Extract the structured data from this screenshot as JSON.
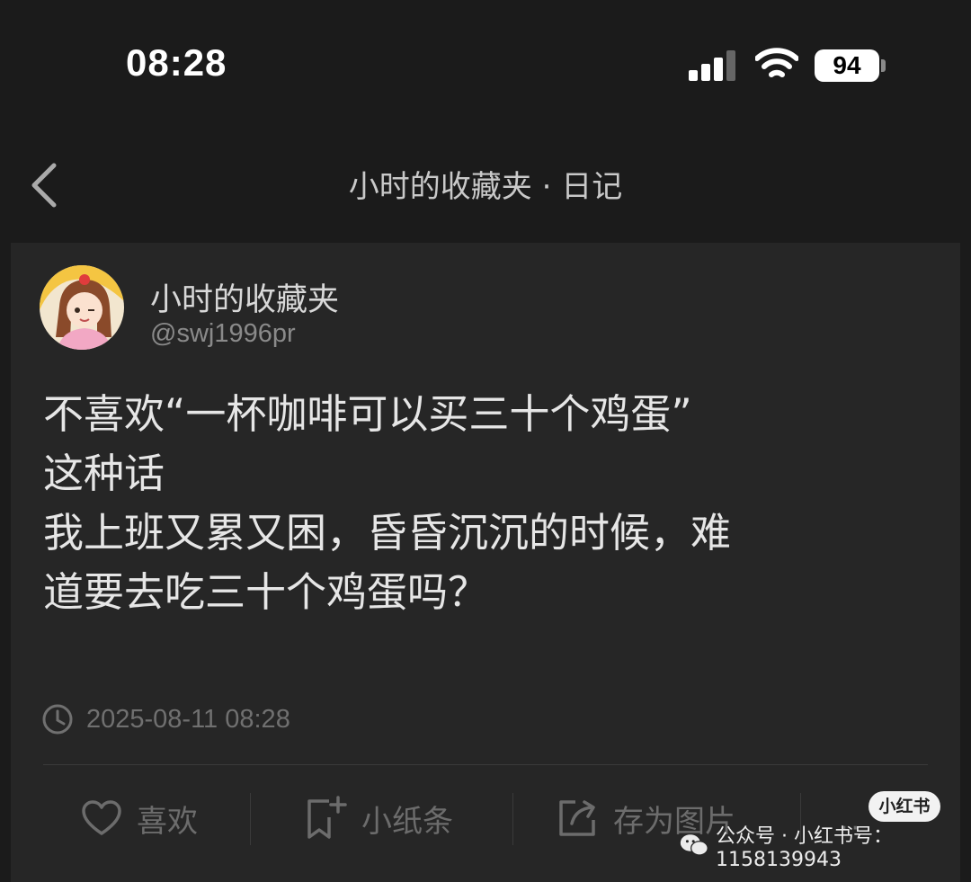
{
  "status_bar": {
    "time": "08:28",
    "battery": "94"
  },
  "nav": {
    "title": "小时的收藏夹 · 日记"
  },
  "post": {
    "author_name": "小时的收藏夹",
    "author_handle": "@swj1996pr",
    "lines": [
      "不喜欢“一杯咖啡可以买三十个鸡蛋”",
      "这种话",
      "我上班又累又困，昏昏沉沉的时候，难",
      "道要去吃三十个鸡蛋吗？"
    ],
    "timestamp": "2025-08-11 08:28"
  },
  "actions": {
    "like": "喜欢",
    "note": "小纸条",
    "save_image": "存为图片",
    "more": "··"
  },
  "watermark": {
    "badge": "小红书",
    "text": "公众号 · 小红书号：1158139943"
  },
  "colors": {
    "background": "#1b1b1b",
    "card": "#262626",
    "text": "#e6e6e6",
    "muted": "#6c6c6c"
  }
}
